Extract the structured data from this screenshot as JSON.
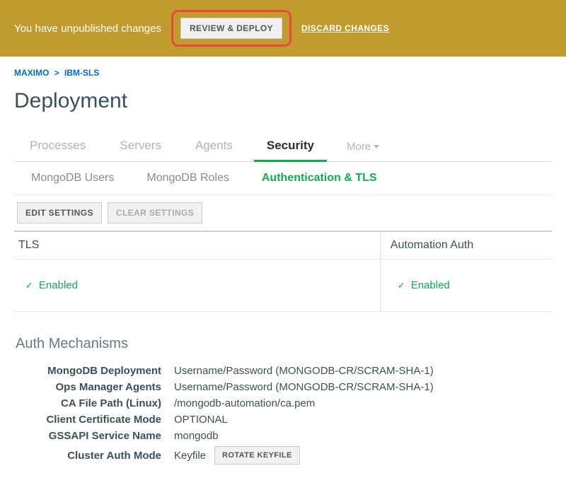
{
  "banner": {
    "message": "You have unpublished changes",
    "review_label": "REVIEW & DEPLOY",
    "discard_label": "DISCARD CHANGES"
  },
  "breadcrumb": {
    "root": "MAXIMO",
    "sep": ">",
    "leaf": "IBM-SLS"
  },
  "page_title": "Deployment",
  "tabs": {
    "items": [
      "Processes",
      "Servers",
      "Agents",
      "Security"
    ],
    "active_index": 3,
    "more_label": "More"
  },
  "subtabs": {
    "items": [
      "MongoDB Users",
      "MongoDB Roles",
      "Authentication & TLS"
    ],
    "active_index": 2
  },
  "actions": {
    "edit_label": "EDIT SETTINGS",
    "clear_label": "CLEAR SETTINGS"
  },
  "status_cols": {
    "left_head": "TLS",
    "right_head": "Automation Auth",
    "left_value": "Enabled",
    "right_value": "Enabled"
  },
  "auth_section": {
    "title": "Auth Mechanisms",
    "rows": [
      {
        "k": "MongoDB Deployment",
        "v": "Username/Password (MONGODB-CR/SCRAM-SHA-1)"
      },
      {
        "k": "Ops Manager Agents",
        "v": "Username/Password (MONGODB-CR/SCRAM-SHA-1)"
      },
      {
        "k": "CA File Path (Linux)",
        "v": "/mongodb-automation/ca.pem"
      },
      {
        "k": "Client Certificate Mode",
        "v": "OPTIONAL"
      },
      {
        "k": "GSSAPI Service Name",
        "v": "mongodb"
      },
      {
        "k": "Cluster Auth Mode",
        "v": "Keyfile",
        "button": "ROTATE KEYFILE"
      }
    ]
  }
}
